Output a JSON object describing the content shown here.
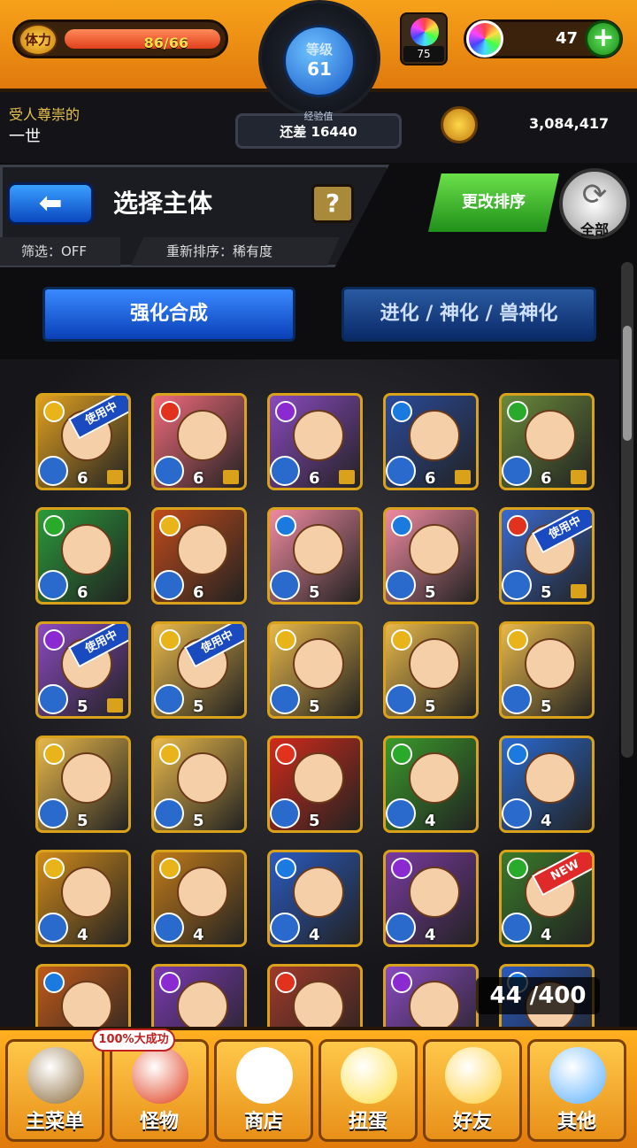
{
  "status": {
    "stamina_label": "体力",
    "stamina_value": "86/66",
    "level_label": "等级",
    "level_value": "61",
    "gem_count": "75",
    "orbs": "47",
    "plus_symbol": "+"
  },
  "player": {
    "title": "受人尊崇的",
    "name": "一世",
    "exp_label": "经验值",
    "exp_value": "还差 16440",
    "coins": "3,084,417"
  },
  "header": {
    "back_symbol": "⬅",
    "title": "选择主体",
    "help_symbol": "?",
    "filter": "筛选：OFF",
    "reorder": "重新排序：稀有度",
    "change_sort": "更改排序",
    "refresh_symbol": "⟳",
    "all_label": "全部"
  },
  "tabs": [
    {
      "label": "强化合成"
    },
    {
      "label": "进化 / 神化 / 兽神化"
    }
  ],
  "colors": {
    "fire": "#e0321c",
    "water": "#1a7ae0",
    "wood": "#2aaa2a",
    "light": "#e8b41a",
    "dark": "#8a2ad0"
  },
  "monsters": [
    {
      "level": "6",
      "tag": "使用中",
      "lock": true,
      "element": "light",
      "bg": "#e0a020"
    },
    {
      "level": "6",
      "tag": "",
      "lock": true,
      "element": "fire",
      "bg": "#f06a7a"
    },
    {
      "level": "6",
      "tag": "",
      "lock": true,
      "element": "dark",
      "bg": "#8a4ac0"
    },
    {
      "level": "6",
      "tag": "",
      "lock": true,
      "element": "water",
      "bg": "#2a4a9a"
    },
    {
      "level": "6",
      "tag": "",
      "lock": true,
      "element": "wood",
      "bg": "#6a8a3a"
    },
    {
      "level": "6",
      "tag": "",
      "lock": false,
      "element": "wood",
      "bg": "#2a9a3a"
    },
    {
      "level": "6",
      "tag": "",
      "lock": false,
      "element": "light",
      "bg": "#c04a1a"
    },
    {
      "level": "5",
      "tag": "",
      "lock": false,
      "element": "water",
      "bg": "#f08aa0"
    },
    {
      "level": "5",
      "tag": "",
      "lock": false,
      "element": "water",
      "bg": "#f08aa0"
    },
    {
      "level": "5",
      "tag": "使用中",
      "lock": true,
      "element": "fire",
      "bg": "#3a6ad0"
    },
    {
      "level": "5",
      "tag": "使用中",
      "lock": true,
      "element": "dark",
      "bg": "#8a4ac0"
    },
    {
      "level": "5",
      "tag": "使用中",
      "lock": false,
      "element": "light",
      "bg": "#e8b84a"
    },
    {
      "level": "5",
      "tag": "",
      "lock": false,
      "element": "light",
      "bg": "#e8b84a"
    },
    {
      "level": "5",
      "tag": "",
      "lock": false,
      "element": "light",
      "bg": "#e8b84a"
    },
    {
      "level": "5",
      "tag": "",
      "lock": false,
      "element": "light",
      "bg": "#e8b84a"
    },
    {
      "level": "5",
      "tag": "",
      "lock": false,
      "element": "light",
      "bg": "#e8b84a"
    },
    {
      "level": "5",
      "tag": "",
      "lock": false,
      "element": "light",
      "bg": "#e8b84a"
    },
    {
      "level": "5",
      "tag": "",
      "lock": false,
      "element": "fire",
      "bg": "#d02a1a"
    },
    {
      "level": "4",
      "tag": "",
      "lock": false,
      "element": "wood",
      "bg": "#3a9a2a"
    },
    {
      "level": "4",
      "tag": "",
      "lock": false,
      "element": "water",
      "bg": "#2a6ad0"
    },
    {
      "level": "4",
      "tag": "",
      "lock": false,
      "element": "light",
      "bg": "#d08a1a"
    },
    {
      "level": "4",
      "tag": "",
      "lock": false,
      "element": "light",
      "bg": "#c07a1a"
    },
    {
      "level": "4",
      "tag": "",
      "lock": false,
      "element": "water",
      "bg": "#2a5ac0"
    },
    {
      "level": "4",
      "tag": "",
      "lock": false,
      "element": "dark",
      "bg": "#7a3aa0"
    },
    {
      "level": "4",
      "tag": "NEW",
      "lock": false,
      "element": "wood",
      "bg": "#3a7a2a"
    },
    {
      "level": "",
      "tag": "",
      "lock": false,
      "element": "water",
      "bg": "#c05a1a"
    },
    {
      "level": "",
      "tag": "",
      "lock": false,
      "element": "dark",
      "bg": "#7a3ab0"
    },
    {
      "level": "",
      "tag": "",
      "lock": false,
      "element": "fire",
      "bg": "#a03a2a"
    },
    {
      "level": "",
      "tag": "",
      "lock": false,
      "element": "dark",
      "bg": "#8a4ac0"
    },
    {
      "level": "",
      "tag": "",
      "lock": false,
      "element": "water",
      "bg": "#2a5ac0"
    }
  ],
  "counter": "44 /400",
  "nav": {
    "promo": "100%大成功",
    "items": [
      {
        "label": "主菜单",
        "icon": "home-gate-icon",
        "color": "#8a6a3a"
      },
      {
        "label": "怪物",
        "icon": "monster-icon",
        "color": "#e03a1a"
      },
      {
        "label": "商店",
        "icon": "rainbow-orb-icon",
        "color": "#ffffff"
      },
      {
        "label": "扭蛋",
        "icon": "egg-icon",
        "color": "#ffe04a"
      },
      {
        "label": "好友",
        "icon": "friends-balloon-icon",
        "color": "#ffd03a"
      },
      {
        "label": "其他",
        "icon": "other-arrow-icon",
        "color": "#5ab0ff"
      }
    ]
  }
}
